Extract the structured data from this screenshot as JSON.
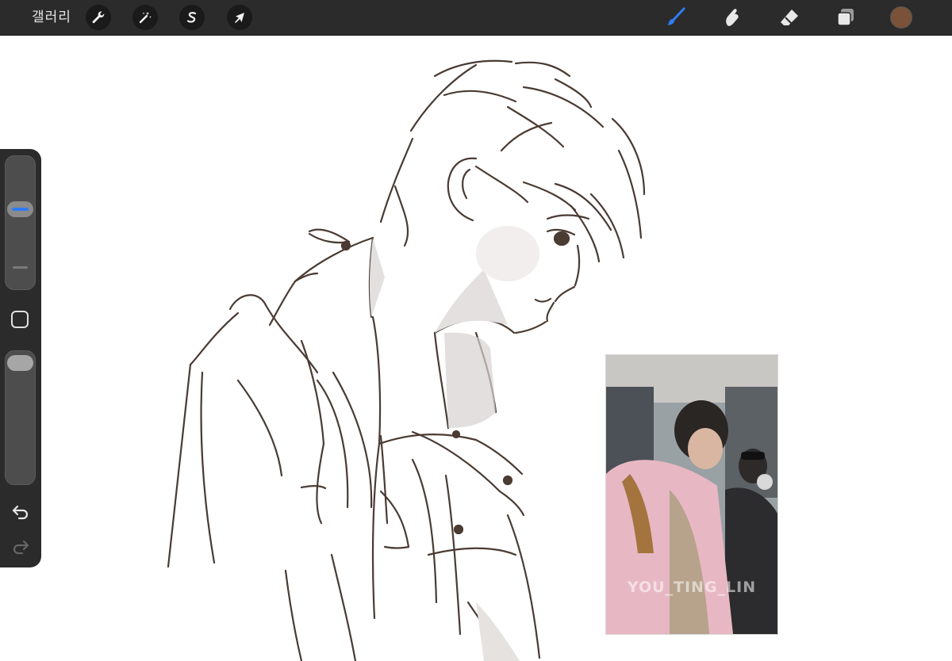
{
  "topbar": {
    "gallery_label": "갤러리",
    "left_tools": [
      {
        "name": "actions",
        "icon": "wrench-icon"
      },
      {
        "name": "adjustments",
        "icon": "magic-wand-icon"
      },
      {
        "name": "selection",
        "icon": "selection-s-icon"
      },
      {
        "name": "transform",
        "icon": "arrow-cursor-icon"
      }
    ],
    "right_tools": [
      {
        "name": "brush",
        "icon": "brush-icon",
        "active": true,
        "color": "#2f7cf6"
      },
      {
        "name": "smudge",
        "icon": "smudge-finger-icon"
      },
      {
        "name": "eraser",
        "icon": "eraser-icon"
      },
      {
        "name": "layers",
        "icon": "layers-icon"
      }
    ],
    "current_color": "#7a5239"
  },
  "sidebar": {
    "brush_size_level": 0.62,
    "brush_opacity_level": 1.0,
    "accent": "#2f7cf6"
  },
  "reference": {
    "watermark": "YOU_TING_LIN"
  }
}
